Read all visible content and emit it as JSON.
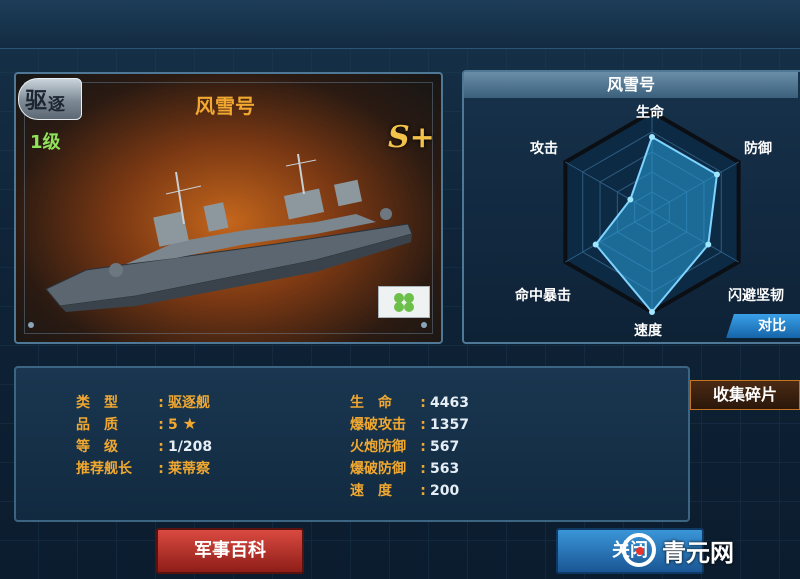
{
  "ship_card": {
    "type_badge_char1": "驱",
    "type_badge_char2": "逐",
    "level": "1级",
    "name": "风雪号",
    "rank": "S+"
  },
  "radar": {
    "title": "风雪号",
    "axes": [
      "生命",
      "防御",
      "闪避坚韧",
      "速度",
      "命中暴击",
      "攻击"
    ],
    "values": [
      0.75,
      0.75,
      0.65,
      1.0,
      0.65,
      0.25
    ],
    "compare_label": "对比",
    "accent_color": "#2a9fd8"
  },
  "info": {
    "left": [
      {
        "key": "类　型",
        "value": "驱逐舰",
        "color": "orange"
      },
      {
        "key": "品　质",
        "value": "5",
        "star": "★",
        "color": "orange"
      },
      {
        "key": "等　级",
        "value": "1/208",
        "color": "white"
      },
      {
        "key": "推荐舰长",
        "value": "莱蒂察",
        "color": "orange"
      }
    ],
    "right": [
      {
        "key": "生　命",
        "value": "4463"
      },
      {
        "key": "爆破攻击",
        "value": "1357"
      },
      {
        "key": "火炮防御",
        "value": "567"
      },
      {
        "key": "爆破防御",
        "value": "563"
      },
      {
        "key": "速　度",
        "value": "200"
      }
    ],
    "collect_label": "收集碎片"
  },
  "buttons": {
    "encyclopedia": "军事百科",
    "close": "关闭"
  },
  "watermark": {
    "text": "青元网"
  }
}
